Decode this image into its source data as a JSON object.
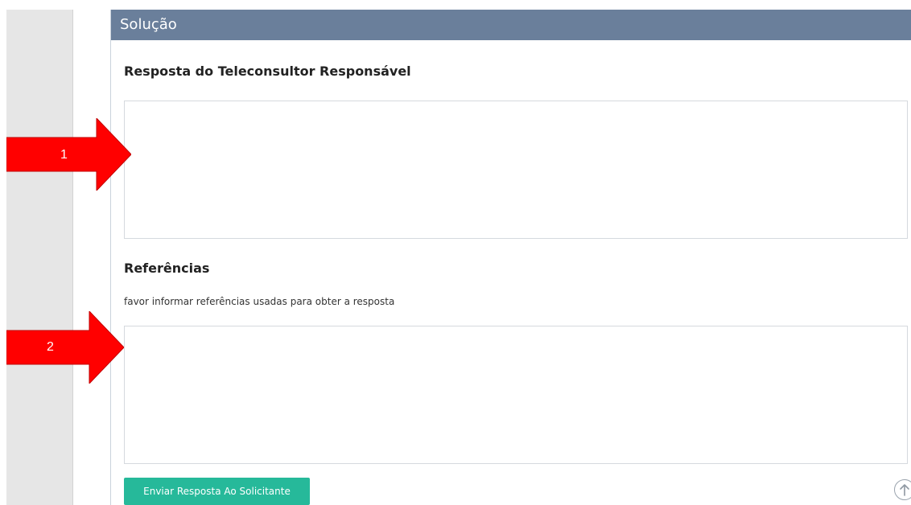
{
  "panel": {
    "header_title": "Solução",
    "response_title": "Resposta do Teleconsultor Responsável",
    "references_title": "Referências",
    "references_hint": "favor informar referências usadas para obter a resposta",
    "send_label": "Enviar Resposta Ao Solicitante"
  },
  "annotations": {
    "arrow_1": "1",
    "arrow_2": "2"
  },
  "colors": {
    "header_bg": "#6a7f9b",
    "button_bg": "#26b99a",
    "arrow_red": "#ff0000"
  },
  "icons": {
    "scroll_top": "arrow-up-circle-icon"
  }
}
